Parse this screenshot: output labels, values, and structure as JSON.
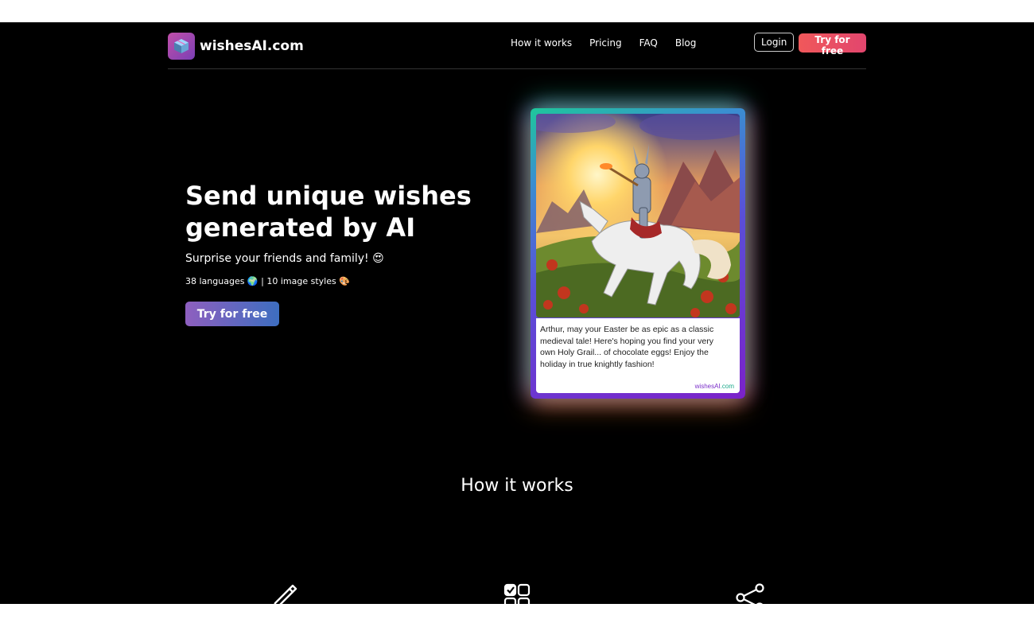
{
  "nav": {
    "brand": "wishesAI.com",
    "links": [
      "How it works",
      "Pricing",
      "FAQ",
      "Blog"
    ],
    "login": "Login",
    "try_free": "Try for free"
  },
  "hero": {
    "title": "Send unique wishes generated by AI",
    "subtitle": "Surprise your friends and family! 😍",
    "meta": "38 languages 🌍 | 10 image styles 🎨",
    "cta": "Try for free"
  },
  "card": {
    "message": "Arthur, may your Easter be as epic as a classic medieval tale! Here's hoping you find your very own Holy Grail... of chocolate eggs! Enjoy the holiday in true knightly fashion!",
    "brand_prefix": "wishesAI",
    "brand_suffix": ".com"
  },
  "how_it_works": {
    "title": "How it works",
    "steps": [
      {
        "icon": "pencil-icon"
      },
      {
        "icon": "grid-select-icon"
      },
      {
        "icon": "share-icon"
      }
    ]
  },
  "colors": {
    "background": "#000000",
    "accent_red": "#e8505f",
    "accent_purple": "#8e5fbf",
    "accent_blue": "#3d6ec0"
  }
}
